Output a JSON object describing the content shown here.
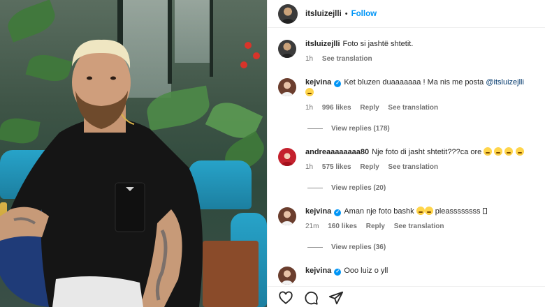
{
  "post": {
    "author": "itsluizejlli",
    "separator": "•",
    "follow_label": "Follow",
    "caption": {
      "username": "itsluizejlli",
      "text": "Foto si jashtë shtetit.",
      "time": "1h",
      "translate": "See translation"
    }
  },
  "comments": [
    {
      "username": "kejvina",
      "verified": true,
      "text": "Ket bluzen duaaaaaaa ! Ma nis me posta",
      "mention": "@itsluizejlli",
      "time": "1h",
      "likes": "996 likes",
      "reply": "Reply",
      "translate": "See translation",
      "view_replies": "View replies (178)"
    },
    {
      "username": "andreaaaaaaaa80",
      "verified": false,
      "text": "Nje foto di jasht shtetit???ca ore",
      "time": "1h",
      "likes": "575 likes",
      "reply": "Reply",
      "translate": "See translation",
      "view_replies": "View replies (20)"
    },
    {
      "username": "kejvina",
      "verified": true,
      "text": "Aman nje foto bashk",
      "text_after": "pleassssssss",
      "time": "21m",
      "likes": "160 likes",
      "reply": "Reply",
      "translate": "See translation",
      "view_replies": "View replies (36)"
    },
    {
      "username": "kejvina",
      "verified": true,
      "text": "Ooo luiz o yll"
    }
  ],
  "icons": {
    "like": "heart-icon",
    "comment": "comment-icon",
    "share": "share-icon",
    "verified": "verified-badge-icon",
    "emoji_crying": "crying-emoji-icon",
    "emoji_laughing": "laughing-emoji-icon"
  },
  "colors": {
    "follow": "#0095f6",
    "verified": "#0095f6",
    "muted": "#737373",
    "mention": "#00376b"
  }
}
